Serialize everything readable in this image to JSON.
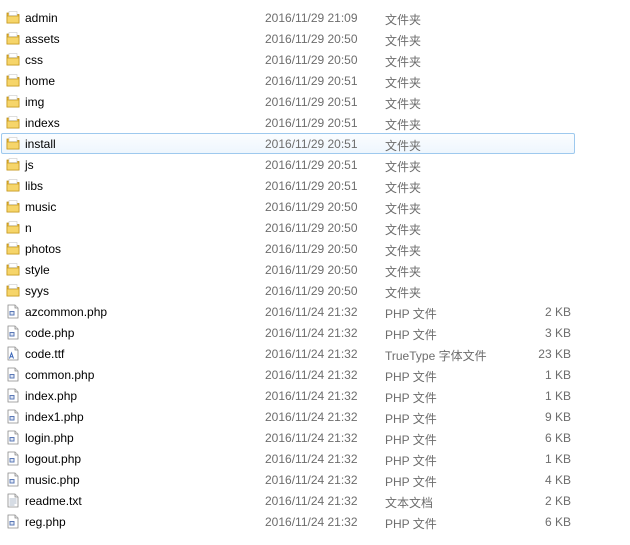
{
  "files": [
    {
      "name": "admin",
      "date": "2016/11/29 21:09",
      "type": "文件夹",
      "size": "",
      "icon": "folder-icon"
    },
    {
      "name": "assets",
      "date": "2016/11/29 20:50",
      "type": "文件夹",
      "size": "",
      "icon": "folder-icon"
    },
    {
      "name": "css",
      "date": "2016/11/29 20:50",
      "type": "文件夹",
      "size": "",
      "icon": "folder-icon"
    },
    {
      "name": "home",
      "date": "2016/11/29 20:51",
      "type": "文件夹",
      "size": "",
      "icon": "folder-icon"
    },
    {
      "name": "img",
      "date": "2016/11/29 20:51",
      "type": "文件夹",
      "size": "",
      "icon": "folder-icon"
    },
    {
      "name": "indexs",
      "date": "2016/11/29 20:51",
      "type": "文件夹",
      "size": "",
      "icon": "folder-icon"
    },
    {
      "name": "install",
      "date": "2016/11/29 20:51",
      "type": "文件夹",
      "size": "",
      "icon": "folder-icon",
      "selected": true
    },
    {
      "name": "js",
      "date": "2016/11/29 20:51",
      "type": "文件夹",
      "size": "",
      "icon": "folder-icon"
    },
    {
      "name": "libs",
      "date": "2016/11/29 20:51",
      "type": "文件夹",
      "size": "",
      "icon": "folder-icon"
    },
    {
      "name": "music",
      "date": "2016/11/29 20:50",
      "type": "文件夹",
      "size": "",
      "icon": "folder-icon"
    },
    {
      "name": "n",
      "date": "2016/11/29 20:50",
      "type": "文件夹",
      "size": "",
      "icon": "folder-icon"
    },
    {
      "name": "photos",
      "date": "2016/11/29 20:50",
      "type": "文件夹",
      "size": "",
      "icon": "folder-icon"
    },
    {
      "name": "style",
      "date": "2016/11/29 20:50",
      "type": "文件夹",
      "size": "",
      "icon": "folder-icon"
    },
    {
      "name": "syys",
      "date": "2016/11/29 20:50",
      "type": "文件夹",
      "size": "",
      "icon": "folder-icon"
    },
    {
      "name": "azcommon.php",
      "date": "2016/11/24 21:32",
      "type": "PHP 文件",
      "size": "2 KB",
      "icon": "php-file-icon"
    },
    {
      "name": "code.php",
      "date": "2016/11/24 21:32",
      "type": "PHP 文件",
      "size": "3 KB",
      "icon": "php-file-icon"
    },
    {
      "name": "code.ttf",
      "date": "2016/11/24 21:32",
      "type": "TrueType 字体文件",
      "size": "23 KB",
      "icon": "font-file-icon"
    },
    {
      "name": "common.php",
      "date": "2016/11/24 21:32",
      "type": "PHP 文件",
      "size": "1 KB",
      "icon": "php-file-icon"
    },
    {
      "name": "index.php",
      "date": "2016/11/24 21:32",
      "type": "PHP 文件",
      "size": "1 KB",
      "icon": "php-file-icon"
    },
    {
      "name": "index1.php",
      "date": "2016/11/24 21:32",
      "type": "PHP 文件",
      "size": "9 KB",
      "icon": "php-file-icon"
    },
    {
      "name": "login.php",
      "date": "2016/11/24 21:32",
      "type": "PHP 文件",
      "size": "6 KB",
      "icon": "php-file-icon"
    },
    {
      "name": "logout.php",
      "date": "2016/11/24 21:32",
      "type": "PHP 文件",
      "size": "1 KB",
      "icon": "php-file-icon"
    },
    {
      "name": "music.php",
      "date": "2016/11/24 21:32",
      "type": "PHP 文件",
      "size": "4 KB",
      "icon": "php-file-icon"
    },
    {
      "name": "readme.txt",
      "date": "2016/11/24 21:32",
      "type": "文本文档",
      "size": "2 KB",
      "icon": "text-file-icon"
    },
    {
      "name": "reg.php",
      "date": "2016/11/24 21:32",
      "type": "PHP 文件",
      "size": "6 KB",
      "icon": "php-file-icon"
    }
  ],
  "colors": {
    "selection_border": "#9ec9ee",
    "selection_fill": "#eef6fd",
    "folder_yellow": "#f2c94c",
    "secondary_text": "#6d6d6d"
  }
}
